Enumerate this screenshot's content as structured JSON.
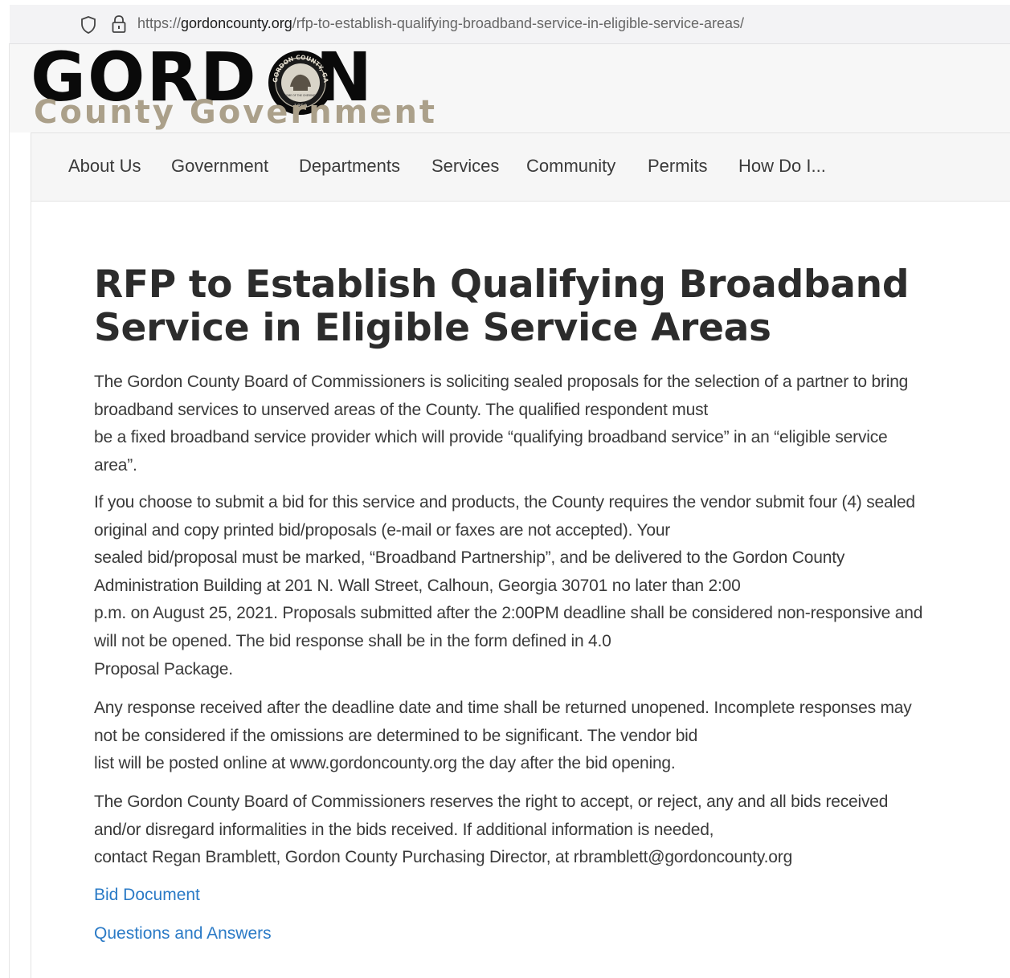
{
  "browser": {
    "url_host_prefix": "https://",
    "url_host": "gordoncounty.org",
    "url_path": "/rfp-to-establish-qualifying-broadband-service-in-eligible-service-areas/"
  },
  "logo": {
    "word_top_left": "GORD",
    "word_top_right": "N",
    "word_bottom": "County Government",
    "seal_text_top": "GORDON COUNTY, GA",
    "seal_year": "1850",
    "seal_motto": "HOME OF THE CHEROKEE"
  },
  "nav": {
    "items": [
      "About Us",
      "Government",
      "Departments",
      "Services",
      "Community",
      "Permits",
      "How Do I..."
    ]
  },
  "page": {
    "title_line1": "RFP to Establish Qualifying Broadband",
    "title_line2": "Service in Eligible Service Areas",
    "paragraphs": [
      {
        "lines": [
          "The Gordon County Board of Commissioners is soliciting sealed proposals for the selection of a partner to bring",
          "broadband services to unserved areas of the County. The qualified respondent must",
          "be a fixed broadband service provider which will provide “qualifying broadband service” in an “eligible service",
          "area”."
        ]
      },
      {
        "lines": [
          "If you choose to submit a bid for this service and products, the County requires the vendor submit four (4) sealed",
          "original and copy printed bid/proposals (e-mail or faxes are not accepted). Your",
          "sealed bid/proposal must be marked, “Broadband Partnership”, and be delivered to the Gordon County",
          "Administration Building at 201 N. Wall Street, Calhoun, Georgia 30701 no later than 2:00",
          "p.m. on August 25, 2021. Proposals submitted after the 2:00PM deadline shall be considered non-responsive and",
          "will not be opened. The bid response shall be in the form defined in 4.0",
          "Proposal Package."
        ]
      },
      {
        "lines": [
          "Any response received after the deadline date and time shall be returned unopened. Incomplete responses may",
          "not be considered if the omissions are determined to be significant. The vendor bid",
          "list will be posted online at www.gordoncounty.org the day after the bid opening."
        ]
      },
      {
        "lines": [
          "The Gordon County Board of Commissioners reserves the right to accept, or reject, any and all bids received",
          "and/or disregard informalities in the bids received. If additional information is needed,",
          "contact Regan Bramblett, Gordon County Purchasing Director, at rbramblett@gordoncounty.org"
        ]
      }
    ],
    "links": [
      "Bid Document",
      "Questions and Answers"
    ]
  },
  "colors": {
    "link": "#2a7ac6",
    "logo_black": "#0a0a0a",
    "logo_tan": "#aba08a",
    "title": "#2c2c2c"
  },
  "icons": {
    "tracking_protection": "shield-icon",
    "secure_connection": "lock-icon"
  }
}
